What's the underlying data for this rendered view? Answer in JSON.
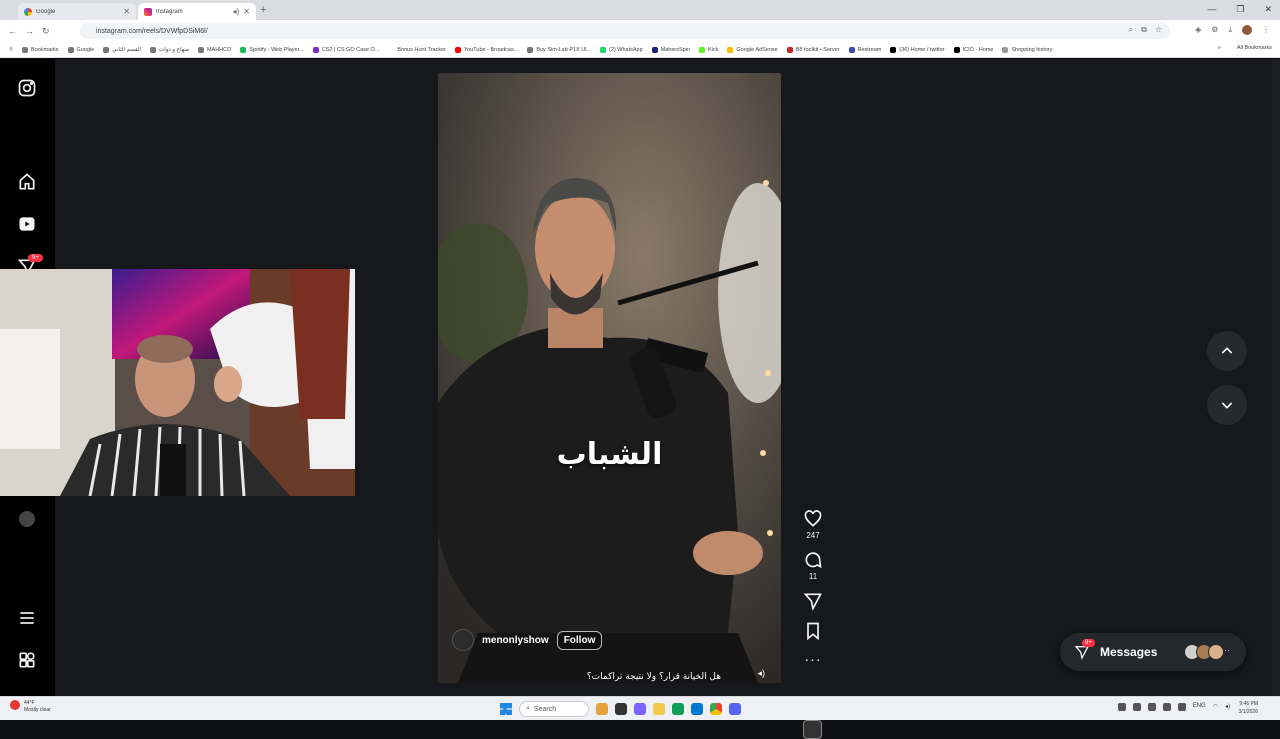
{
  "browser": {
    "tabs": [
      {
        "title": "Google",
        "active": false
      },
      {
        "title": "Instagram",
        "active": true
      }
    ],
    "url": "instagram.com/reels/DVWfpDSiM6l/",
    "bookmarks": [
      "Bookmarks",
      "Google",
      "القسم الثاني",
      "منهاج و دوات",
      "MAHHCO",
      "Spotify - Web Player...",
      "CS2 | CS:GO Case O...",
      "Bonus Hunt Tracker",
      "YouTube - Broadcas...",
      "Buy Sim-Lab P1X Ul...",
      "(2) WhatsApp",
      "MahersSpin",
      "Kick",
      "Google AdSense",
      "B8 toolkit • Server",
      "Restream",
      "(36) Home / twitter",
      "ICIO - Home",
      "Shopping history"
    ],
    "all_bookmarks": "All Bookmarks"
  },
  "instagram": {
    "notification_badge": "9+",
    "reel": {
      "caption_overlay": "الشباب",
      "author": "menonlyshow",
      "follow_label": "Follow",
      "description": "هل الخيانة قرار؟ ولا نتيجة تراكمات؟",
      "likes": "247",
      "comments": "11"
    },
    "messages": {
      "label": "Messages",
      "badge": "9+"
    }
  },
  "taskbar": {
    "weather_temp": "44°F",
    "weather_desc": "Mostly clear",
    "search_label": "Search",
    "time": "9:46 PM",
    "date": "3/1/2026",
    "lang": "ENG"
  },
  "icons": [
    "instagram-logo-icon",
    "home-icon",
    "reels-icon",
    "direct-icon",
    "menu-icon",
    "more-apps-icon",
    "heart-icon",
    "comment-icon",
    "share-icon",
    "bookmark-icon",
    "more-icon",
    "chevron-up-icon",
    "chevron-down-icon"
  ]
}
